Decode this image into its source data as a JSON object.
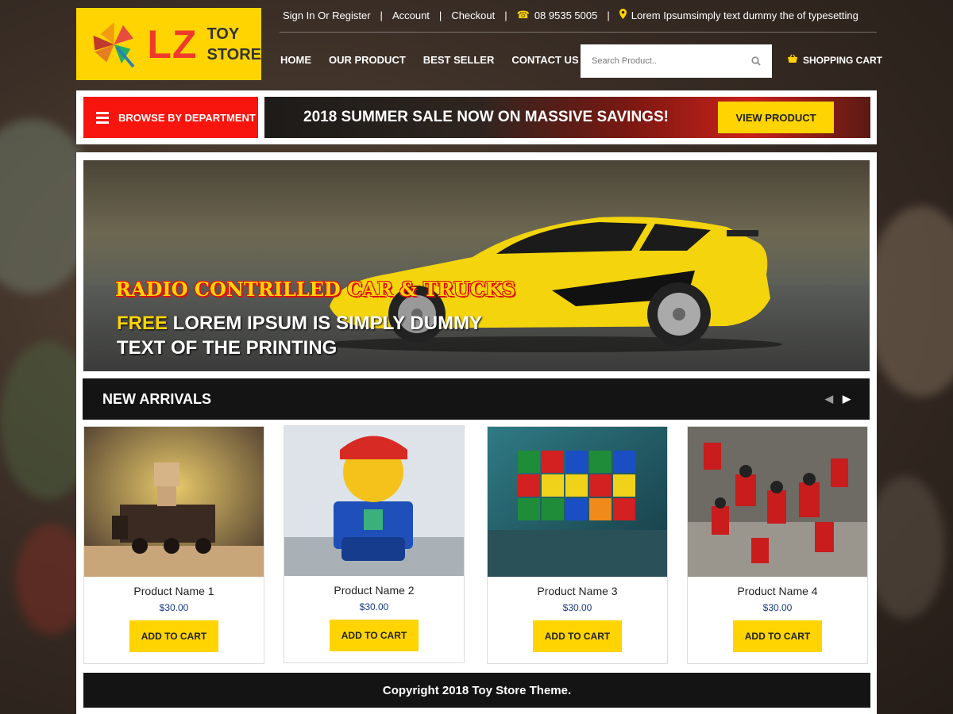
{
  "brand": {
    "logo_main": "LZ",
    "logo_line1": "TOY",
    "logo_line2": "STORE"
  },
  "topbar": {
    "signin": "Sign In Or Register",
    "account": "Account",
    "checkout": "Checkout",
    "phone": "08 9535 5005",
    "address": "Lorem Ipsumsimply text  dummy the of typesetting"
  },
  "nav": {
    "items": [
      "HOME",
      "OUR PRODUCT",
      "BEST SELLER",
      "CONTACT US"
    ]
  },
  "search": {
    "placeholder": "Search Product.."
  },
  "cart": {
    "label": "SHOPPING CART"
  },
  "promo": {
    "department_label": "BROWSE BY DEPARTMENT",
    "sale_text": "2018 SUMMER SALE NOW ON MASSIVE SAVINGS!",
    "view_button": "VIEW PRODUCT"
  },
  "hero": {
    "title": "RADIO CONTRILLED CAR & TRUCKS",
    "line1_highlight": "FREE",
    "line1_rest": " LOREM IPSUM IS SIMPLY DUMMY",
    "line2": "TEXT OF THE PRINTING"
  },
  "arrivals": {
    "heading": "NEW ARRIVALS"
  },
  "products": [
    {
      "name": "Product Name 1",
      "price": "$30.00",
      "button": "ADD TO CART"
    },
    {
      "name": "Product Name 2",
      "price": "$30.00",
      "button": "ADD TO CART"
    },
    {
      "name": "Product Name 3",
      "price": "$30.00",
      "button": "ADD TO CART"
    },
    {
      "name": "Product Name 4",
      "price": "$30.00",
      "button": "ADD TO CART"
    }
  ],
  "footer": {
    "text": "Copyright 2018 Toy Store Theme."
  },
  "colors": {
    "accent": "#ffd400",
    "brand_red": "#f8150d",
    "dark": "#141414",
    "price": "#1a3a8a"
  },
  "icons": [
    "pinwheel-logo",
    "phone-icon",
    "location-pin-icon",
    "search-icon",
    "basket-icon",
    "hamburger-icon",
    "chevron-left-icon",
    "chevron-right-icon"
  ]
}
